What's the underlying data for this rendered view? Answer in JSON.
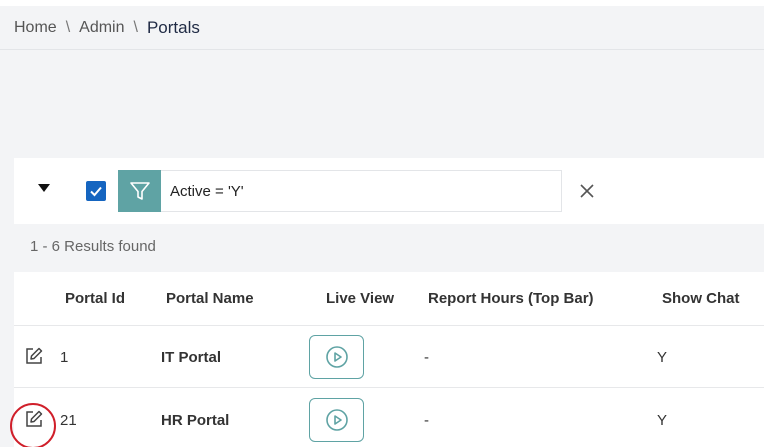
{
  "breadcrumb": {
    "items": [
      {
        "label": "Home"
      },
      {
        "label": "Admin"
      },
      {
        "label": "Portals"
      }
    ],
    "separator": "\\"
  },
  "filter": {
    "checked": true,
    "expression": "Active = 'Y'",
    "icons": {
      "toggle": "caret-down-icon",
      "filter": "funnel-icon",
      "clear": "close-icon"
    },
    "accent": "#5fa3a4",
    "checkbox_color": "#1565c0"
  },
  "results": {
    "text": "1 - 6 Results found"
  },
  "table": {
    "columns": [
      "Portal Id",
      "Portal Name",
      "Live View",
      "Report Hours (Top Bar)",
      "Show Chat"
    ],
    "rows": [
      {
        "id": "1",
        "name": "IT Portal",
        "report_hours": "-",
        "show_chat": "Y"
      },
      {
        "id": "21",
        "name": "HR Portal",
        "report_hours": "-",
        "show_chat": "Y"
      }
    ],
    "icons": {
      "edit": "edit-icon",
      "live": "play-circle-icon"
    }
  },
  "annotation": {
    "color": "#d01f2a"
  }
}
